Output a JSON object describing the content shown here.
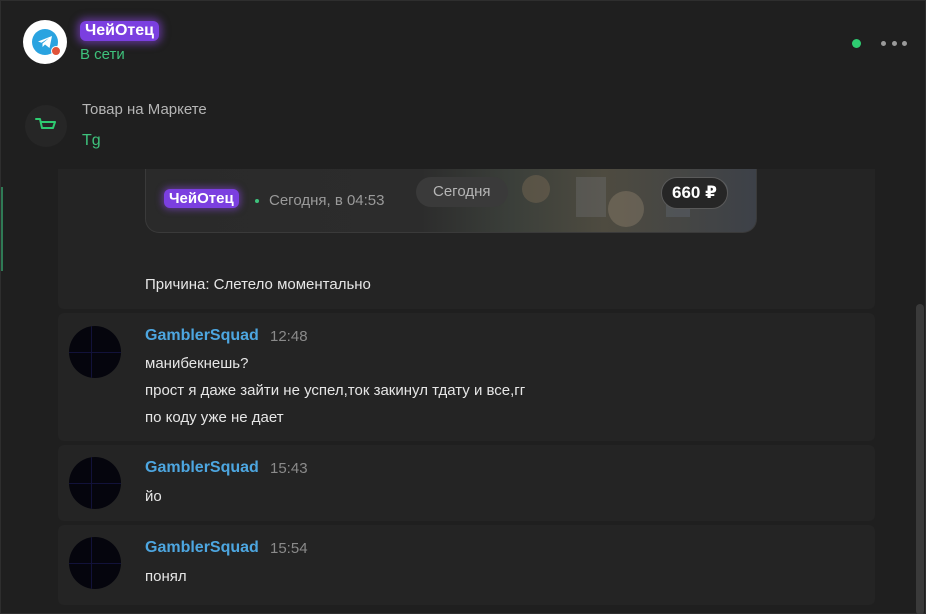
{
  "header": {
    "chat_name": "ЧейОтец",
    "status": "В сети",
    "avatar_icon": "telegram-icon",
    "online_color": "#2ecc71"
  },
  "market": {
    "title": "Товар на Маркете",
    "subtitle": "Tg",
    "icon": "cart-icon"
  },
  "product": {
    "seller": "ЧейОтец",
    "time": "Сегодня, в 04:53",
    "date_pill": "Сегодня",
    "price": "660 ₽"
  },
  "reason": "Причина: Слетело моментально",
  "messages": [
    {
      "author": "GamblerSquad",
      "time": "12:48",
      "lines": [
        "манибекнешь?",
        "прост я даже зайти не успел,ток закинул тдату и все,гг",
        "по коду уже не дает"
      ]
    },
    {
      "author": "GamblerSquad",
      "time": "15:43",
      "lines": [
        "йо"
      ]
    },
    {
      "author": "GamblerSquad",
      "time": "15:54",
      "lines": [
        "понял"
      ]
    }
  ],
  "colors": {
    "accent_green": "#3ec27c",
    "author_blue": "#4da6e0",
    "badge_purple": "#7b3fe0",
    "background": "#1f1f1f"
  }
}
